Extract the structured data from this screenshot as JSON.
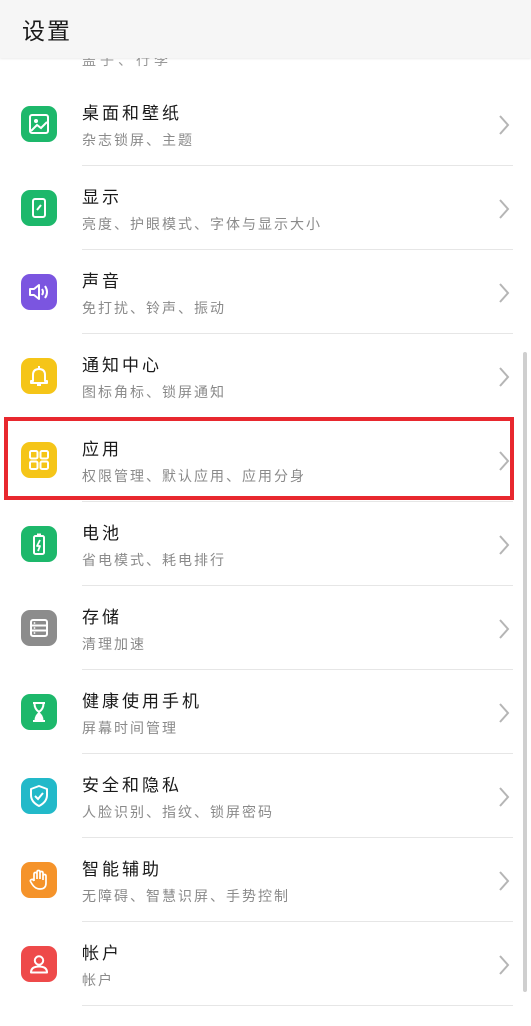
{
  "header": {
    "title": "设置"
  },
  "partial_top_text": "盖子、行李",
  "items": [
    {
      "title": "桌面和壁纸",
      "subtitle": "杂志锁屏、主题",
      "icon": "wallpaper-icon",
      "color": "#1db86b"
    },
    {
      "title": "显示",
      "subtitle": "亮度、护眼模式、字体与显示大小",
      "icon": "display-icon",
      "color": "#1db86b"
    },
    {
      "title": "声音",
      "subtitle": "免打扰、铃声、振动",
      "icon": "speaker-icon",
      "color": "#7b55e0"
    },
    {
      "title": "通知中心",
      "subtitle": "图标角标、锁屏通知",
      "icon": "bell-icon",
      "color": "#f5c518"
    },
    {
      "title": "应用",
      "subtitle": "权限管理、默认应用、应用分身",
      "icon": "apps-grid-icon",
      "color": "#f5c518"
    },
    {
      "title": "电池",
      "subtitle": "省电模式、耗电排行",
      "icon": "battery-icon",
      "color": "#1db86b"
    },
    {
      "title": "存储",
      "subtitle": "清理加速",
      "icon": "storage-icon",
      "color": "#8c8c8c"
    },
    {
      "title": "健康使用手机",
      "subtitle": "屏幕时间管理",
      "icon": "hourglass-icon",
      "color": "#1db86b"
    },
    {
      "title": "安全和隐私",
      "subtitle": "人脸识别、指纹、锁屏密码",
      "icon": "shield-icon",
      "color": "#22b9c9"
    },
    {
      "title": "智能辅助",
      "subtitle": "无障碍、智慧识屏、手势控制",
      "icon": "hand-icon",
      "color": "#f5932a"
    },
    {
      "title": "帐户",
      "subtitle": "帐户",
      "icon": "person-icon",
      "color": "#ee4a4a"
    }
  ]
}
